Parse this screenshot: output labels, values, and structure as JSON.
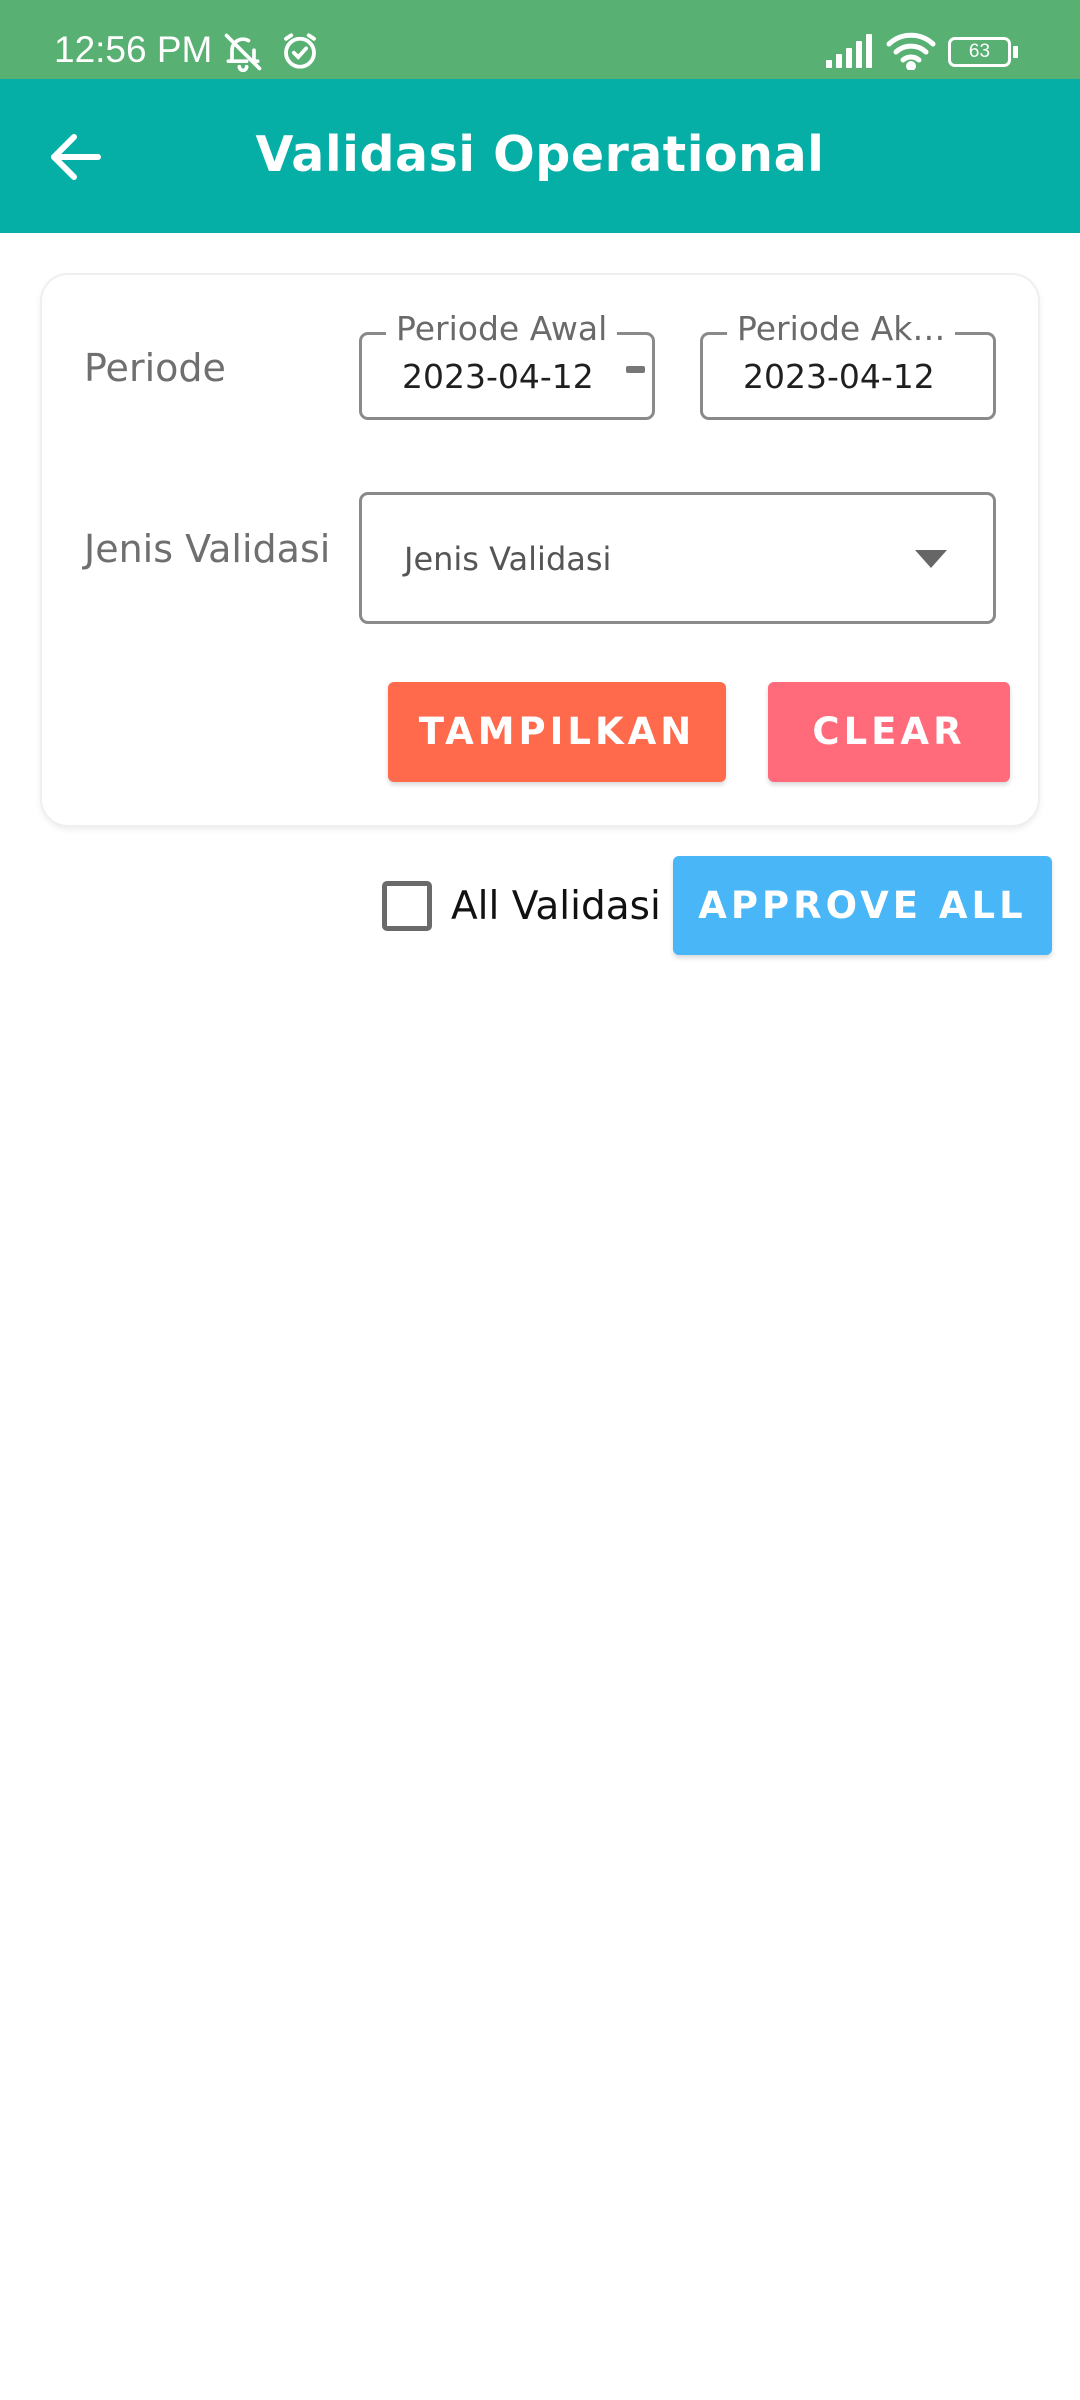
{
  "status_bar": {
    "time": "12:56 PM",
    "battery": "63",
    "icons": [
      "bell-off-icon",
      "alarm-icon",
      "signal-icon",
      "wifi-icon",
      "battery-icon"
    ]
  },
  "app_bar": {
    "title": "Validasi Operational",
    "back_icon": "arrow-left-icon"
  },
  "filter": {
    "periode_label": "Periode",
    "start_date": {
      "legend": "Periode Awal",
      "value": "2023-04-12"
    },
    "end_date": {
      "legend": "Periode Ak…",
      "value": "2023-04-12"
    },
    "jenis_label": "Jenis Validasi",
    "jenis_select": {
      "value": "Jenis Validasi"
    },
    "show_button": "TAMPILKAN",
    "clear_button": "CLEAR"
  },
  "actions": {
    "all_checkbox_label": "All Validasi",
    "all_checked": false,
    "approve_button": "APPROVE ALL"
  },
  "colors": {
    "status_bar": "#58b072",
    "app_bar": "#06afa6",
    "show_button": "#ff6a4c",
    "clear_button": "#ff6b7b",
    "approve_button": "#49b6f8"
  }
}
